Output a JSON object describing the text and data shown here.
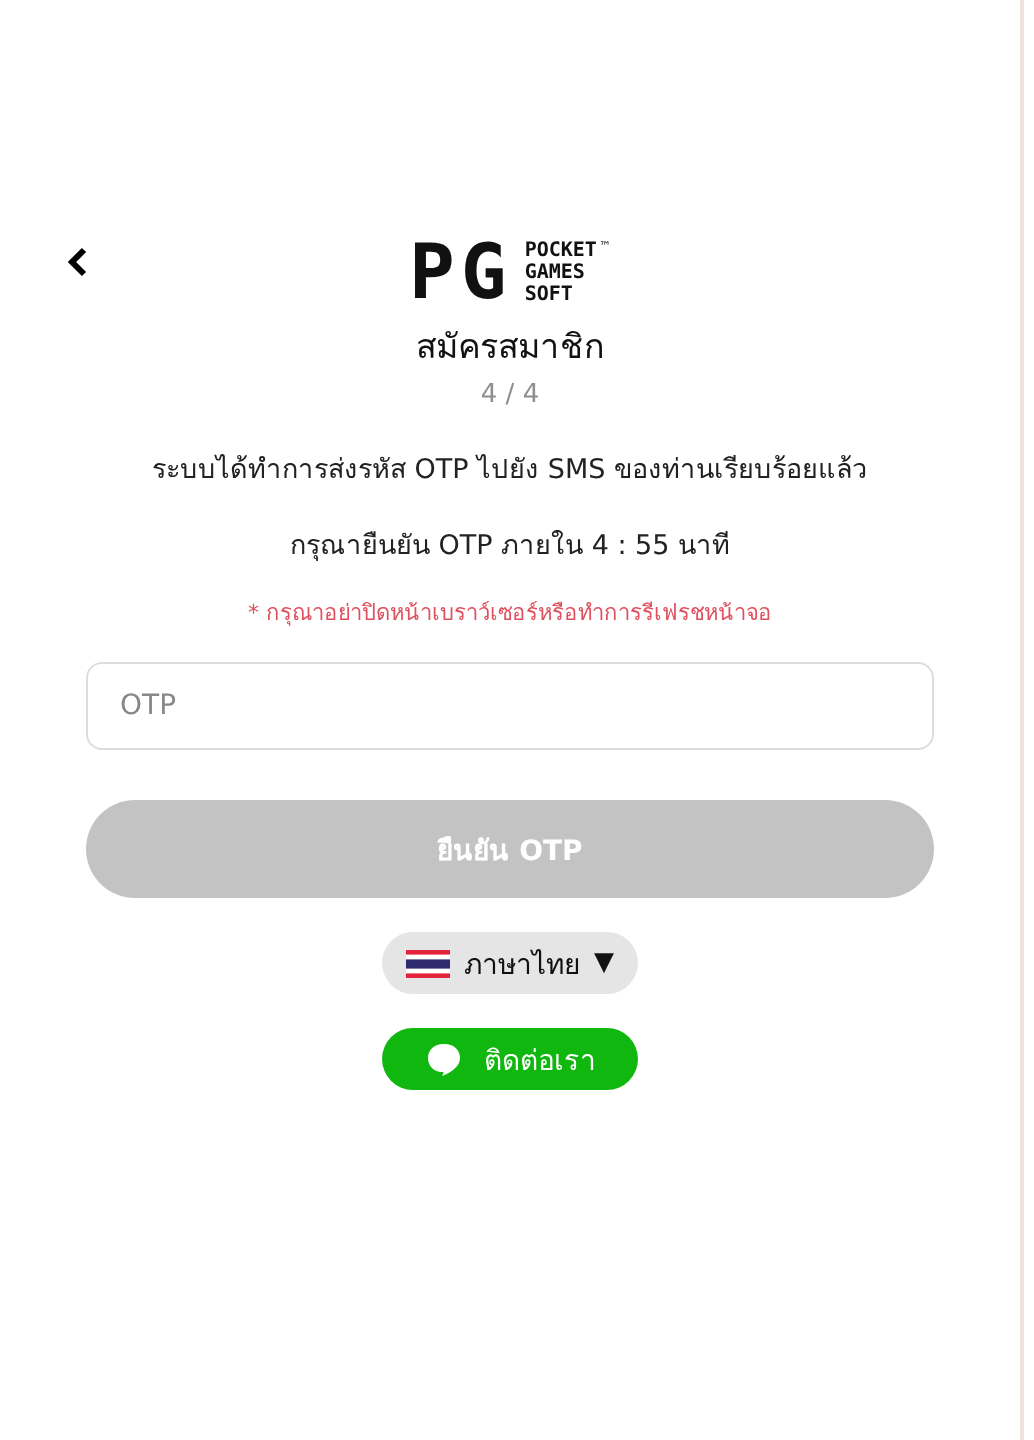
{
  "logo": {
    "mark": "PG",
    "lines": [
      "POCKET",
      "GAMES",
      "SOFT"
    ],
    "trademark": "™"
  },
  "title": "สมัครสมาชิก",
  "step": "4 / 4",
  "messages": [
    "ระบบได้ทำการส่งรหัส OTP ไปยัง SMS ของท่านเรียบร้อยแล้ว",
    "กรุณายืนยัน OTP ภายใน 4 : 55 นาที"
  ],
  "warning": "* กรุณาอย่าปิดหน้าเบราว์เซอร์หรือทำการรีเฟรชหน้าจอ",
  "otp_field": {
    "placeholder": "OTP"
  },
  "submit_button": {
    "label": "ยืนยัน OTP",
    "disabled": true
  },
  "language": {
    "label": "ภาษาไทย",
    "caret": "▼"
  },
  "contact_button": {
    "label": "ติดต่อเรา"
  }
}
